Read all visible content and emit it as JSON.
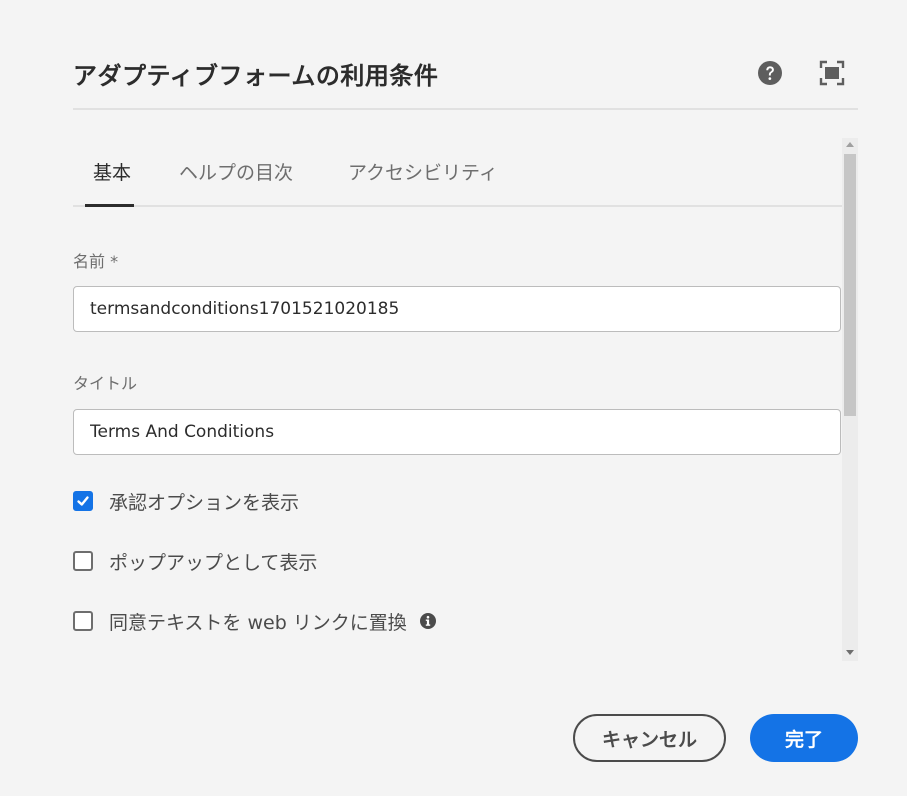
{
  "dialog": {
    "title": "アダプティブフォームの利用条件",
    "header_icons": [
      "help-icon",
      "fullscreen-icon"
    ]
  },
  "tabs": [
    {
      "label": "基本",
      "active": true
    },
    {
      "label": "ヘルプの目次",
      "active": false
    },
    {
      "label": "アクセシビリティ",
      "active": false
    }
  ],
  "fields": {
    "name": {
      "label": "名前 *",
      "value": "termsandconditions1701521020185"
    },
    "title": {
      "label": "タイトル",
      "value": "Terms And Conditions"
    }
  },
  "checkboxes": [
    {
      "label": "承認オプションを表示",
      "checked": true
    },
    {
      "label": "ポップアップとして表示",
      "checked": false
    },
    {
      "label": "同意テキストを web リンクに置換",
      "checked": false,
      "icon": "info-icon"
    }
  ],
  "buttons": {
    "cancel": "キャンセル",
    "done": "完了"
  },
  "colors": {
    "accent": "#1473e6",
    "background": "#f4f4f4"
  }
}
